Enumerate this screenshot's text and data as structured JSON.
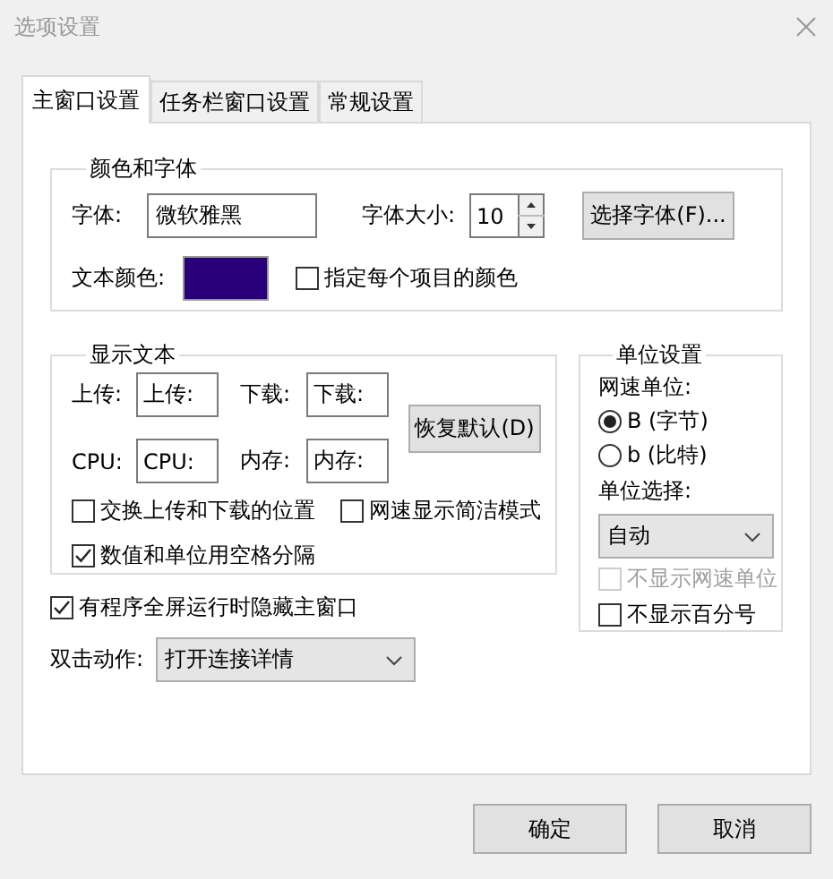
{
  "window": {
    "title": "选项设置"
  },
  "tabs": [
    {
      "label": "主窗口设置",
      "selected": true
    },
    {
      "label": "任务栏窗口设置",
      "selected": false
    },
    {
      "label": "常规设置",
      "selected": false
    }
  ],
  "color_font": {
    "title": "颜色和字体",
    "font_label": "字体:",
    "font_value": "微软雅黑",
    "size_label": "字体大小:",
    "size_value": "10",
    "choose_font_button": "选择字体(F)...",
    "text_color_label": "文本颜色:",
    "text_color_swatch": {
      "color": "#2a007a"
    },
    "per_item_color": {
      "label": "指定每个项目的颜色",
      "checked": false
    }
  },
  "display_text": {
    "title": "显示文本",
    "fields": [
      {
        "label": "上传:",
        "value": "上传:"
      },
      {
        "label": "下载:",
        "value": "下载:"
      },
      {
        "label": "CPU:",
        "value": "CPU:"
      },
      {
        "label": "内存:",
        "value": "内存:"
      }
    ],
    "restore_button": "恢复默认(D)",
    "options": [
      {
        "label": "交换上传和下载的位置",
        "checked": false
      },
      {
        "label": "网速显示简洁模式",
        "checked": false
      },
      {
        "label": "数值和单位用空格分隔",
        "checked": true
      }
    ]
  },
  "hide_on_fullscreen": {
    "label": "有程序全屏运行时隐藏主窗口",
    "checked": true
  },
  "double_click": {
    "label": "双击动作:",
    "value": "打开连接详情"
  },
  "unit_settings": {
    "title": "单位设置",
    "speed_unit_label": "网速单位:",
    "speed_units": [
      {
        "label": "B (字节)",
        "selected": true
      },
      {
        "label": "b (比特)",
        "selected": false
      }
    ],
    "unit_select_label": "单位选择:",
    "unit_select_value": "自动",
    "options": [
      {
        "label": "不显示网速单位",
        "checked": false,
        "disabled": true
      },
      {
        "label": "不显示百分号",
        "checked": false,
        "disabled": false
      }
    ]
  },
  "buttons": [
    {
      "label": "确定"
    },
    {
      "label": "取消"
    }
  ]
}
